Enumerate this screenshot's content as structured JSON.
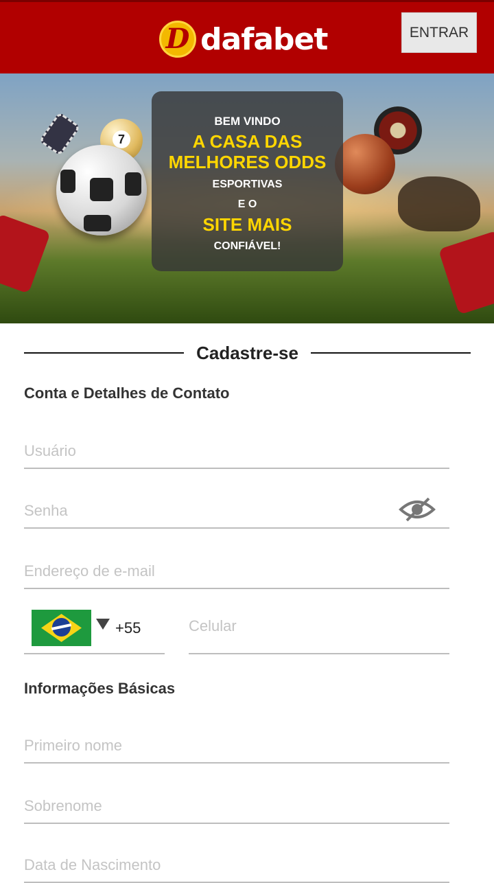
{
  "header": {
    "brand": "dafabet",
    "logo_mark": "D",
    "login_label": "ENTRAR",
    "background_color": "#b10000"
  },
  "banner": {
    "line1": "BEM VINDO",
    "line2": "A CASA DAS",
    "line3": "MELHORES ODDS",
    "line4": "ESPORTIVAS",
    "line5": "E O",
    "line6": "SITE MAIS",
    "line7": "CONFIÁVEL!",
    "billiard_number": "7",
    "highlight_color": "#ffd600"
  },
  "form": {
    "title": "Cadastre-se",
    "section_contact": "Conta e Detalhes de Contato",
    "username_placeholder": "Usuário",
    "password_placeholder": "Senha",
    "password_toggle_icon": "eye-off-icon",
    "email_placeholder": "Endereço de e-mail",
    "country_flag": "brazil-flag-icon",
    "country_code": "+55",
    "phone_placeholder": "Celular",
    "section_basic": "Informações Básicas",
    "firstname_placeholder": "Primeiro nome",
    "lastname_placeholder": "Sobrenome",
    "birthdate_placeholder": "Data de Nascimento"
  }
}
